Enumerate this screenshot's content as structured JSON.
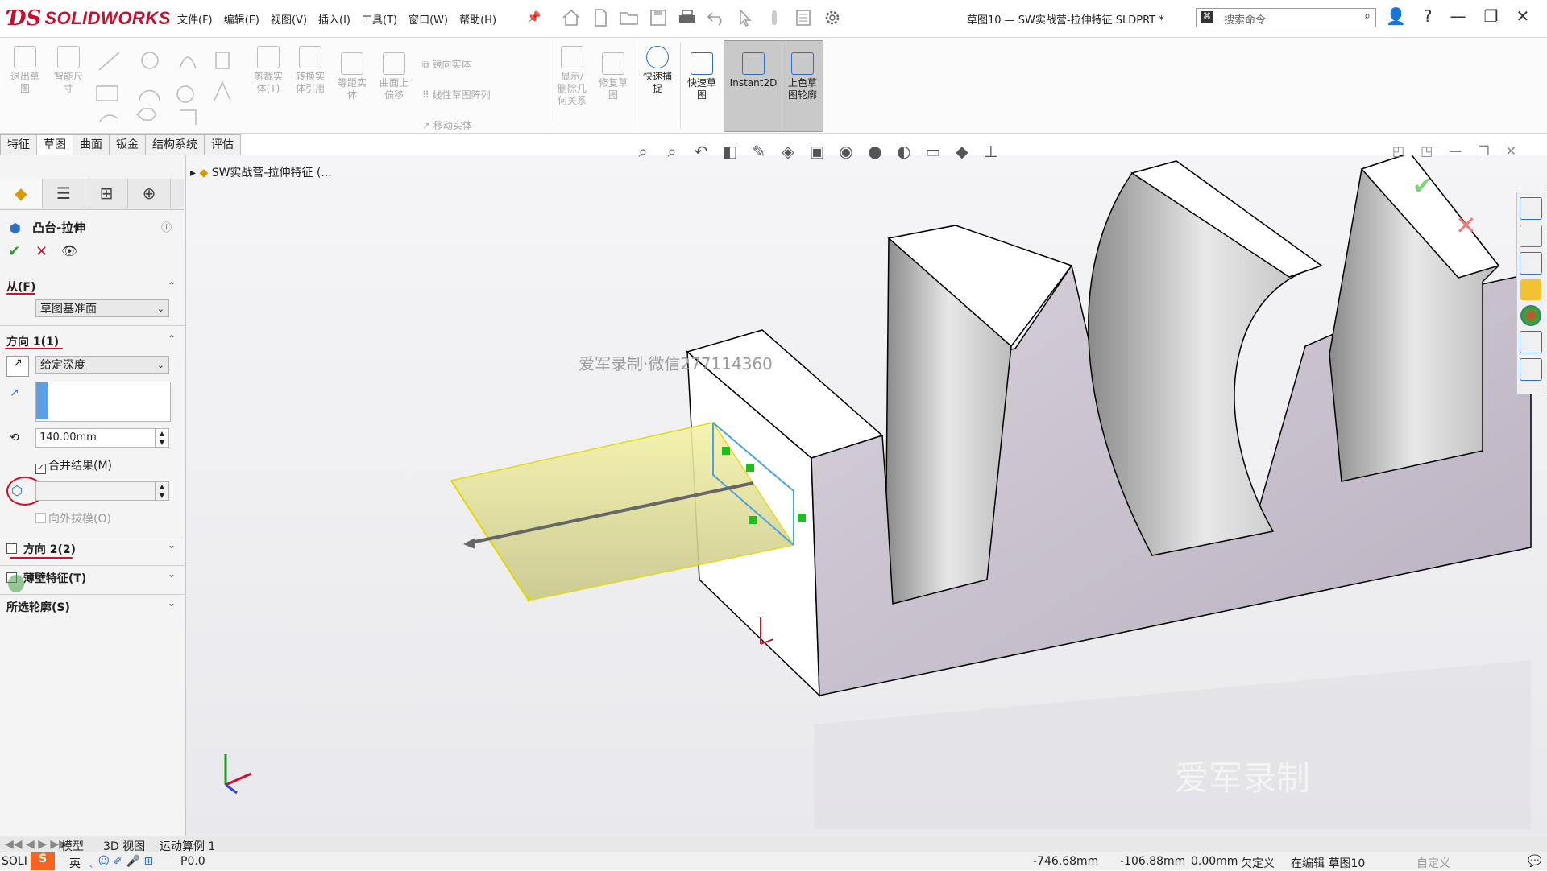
{
  "app": {
    "brand": "SOLIDWORKS",
    "brand_color": "#c8102e"
  },
  "menu": [
    "文件(F)",
    "编辑(E)",
    "视图(V)",
    "插入(I)",
    "工具(T)",
    "窗口(W)",
    "帮助(H)"
  ],
  "document_title": "草图10 — SW实战营-拉伸特征.SLDPRT *",
  "search": {
    "placeholder": "搜索命令"
  },
  "ribbon": {
    "buttons": [
      {
        "label": "退出草\n图"
      },
      {
        "label": "智能尺\n寸"
      },
      {
        "label": "剪裁实\n体(T)"
      },
      {
        "label": "转换实\n体引用"
      },
      {
        "label": "等距实\n体"
      },
      {
        "label": "曲面上\n偏移"
      },
      {
        "label": "显示/\n删除几\n何关系"
      },
      {
        "label": "修复草\n图"
      },
      {
        "label": "快速捕\n捉"
      },
      {
        "label": "快速草\n图"
      },
      {
        "label": "Instant2D"
      },
      {
        "label": "上色草\n图轮廓"
      }
    ],
    "small": [
      "镜向实体",
      "线性草图阵列",
      "移动实体"
    ]
  },
  "command_tabs": [
    "特征",
    "草图",
    "曲面",
    "钣金",
    "结构系统",
    "评估"
  ],
  "active_tab": "草图",
  "tree_item": "SW实战营-拉伸特征 (...",
  "property_manager": {
    "title": "凸台-拉伸",
    "from": {
      "header": "从(F)",
      "value": "草图基准面"
    },
    "direction1": {
      "header": "方向 1(1)",
      "end_condition": "给定深度",
      "depth": "140.00mm",
      "merge_label": "合并结果(M)",
      "merge_checked": true,
      "draft_label": "向外拔模(O)"
    },
    "direction2": {
      "header": "方向 2(2)"
    },
    "thin": {
      "header": "薄壁特征(T)"
    },
    "contours": {
      "header": "所选轮廓(S)"
    }
  },
  "watermarks": {
    "center": "爱军录制·微信277114360",
    "bottom": "爱军录制"
  },
  "bottom_tabs": [
    "模型",
    "3D 视图",
    "运动算例 1"
  ],
  "status": {
    "x": "-746.68mm",
    "y": "-106.88mm",
    "z": "0.00mm",
    "definition": "欠定义",
    "editing": "在编辑 草图10",
    "custom": "自定义",
    "left": "SOLI",
    "left2": "P0.0"
  },
  "ime": {
    "lang": "英"
  }
}
